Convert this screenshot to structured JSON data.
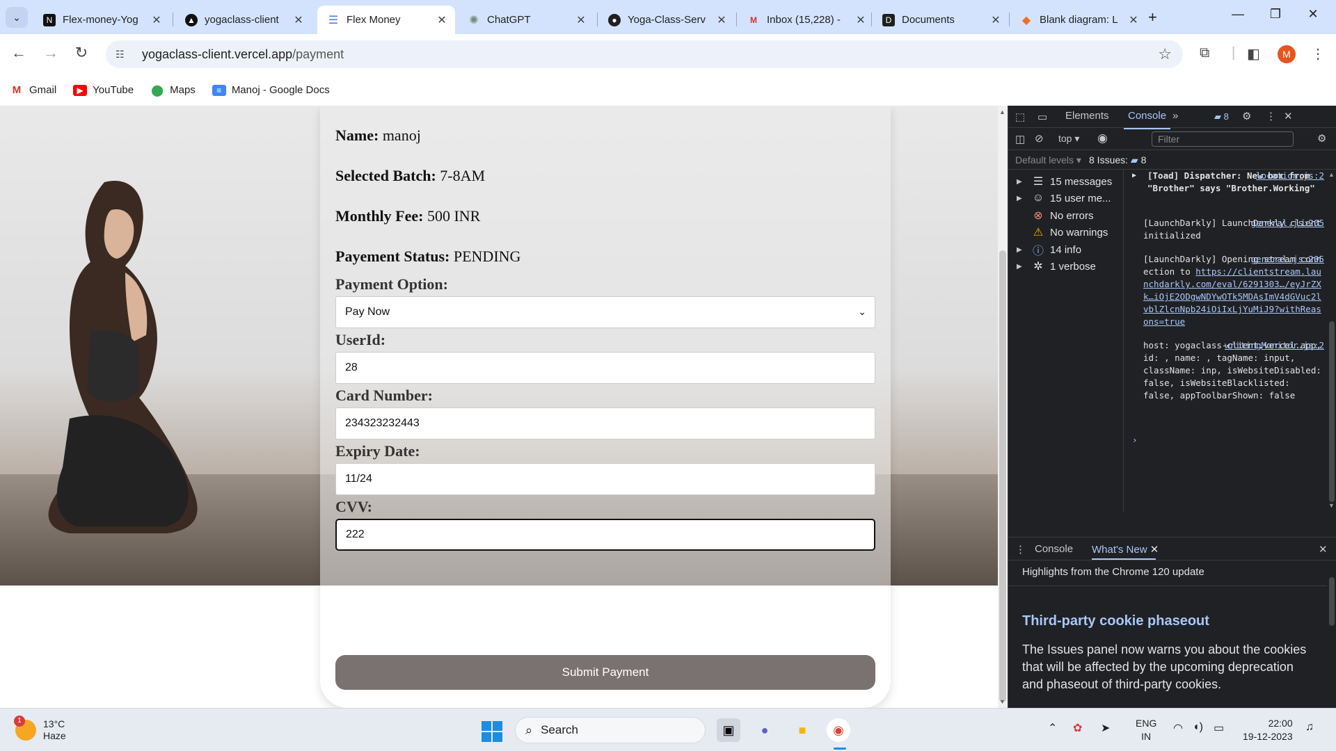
{
  "browser": {
    "tabs": [
      {
        "title": "Flex-money-Yog",
        "active": false
      },
      {
        "title": "yogaclass-client",
        "active": false
      },
      {
        "title": "Flex Money",
        "active": true
      },
      {
        "title": "ChatGPT",
        "active": false
      },
      {
        "title": "Yoga-Class-Serv",
        "active": false
      },
      {
        "title": "Inbox (15,228) -",
        "active": false
      },
      {
        "title": "Documents",
        "active": false
      },
      {
        "title": "Blank diagram: L",
        "active": false
      }
    ],
    "url_host": "yogaclass-client.vercel.app",
    "url_path": "/payment",
    "profile_initial": "M",
    "bookmarks": [
      "Gmail",
      "YouTube",
      "Maps",
      "Manoj - Google Docs"
    ]
  },
  "page": {
    "name_label": "Name:",
    "name_value": "manoj",
    "batch_label": "Selected Batch:",
    "batch_value": "7-8AM",
    "fee_label": "Monthly Fee:",
    "fee_value": "500 INR",
    "status_label": "Payement Status:",
    "status_value": "PENDING",
    "payment_option_label": "Payment Option:",
    "payment_option_value": "Pay Now",
    "userid_label": "UserId:",
    "userid_value": "28",
    "card_label": "Card Number:",
    "card_value": "234323232443",
    "expiry_label": "Expiry Date:",
    "expiry_value": "11/24",
    "cvv_label": "CVV:",
    "cvv_value": "222",
    "submit_label": "Submit Payment"
  },
  "devtools": {
    "tabs": [
      "Elements",
      "Console"
    ],
    "issues_badge": "8",
    "context": "top",
    "filter_placeholder": "Filter",
    "default_levels": "Default levels",
    "issues_label": "8 Issues:",
    "issues_count": "8",
    "sidebar": [
      {
        "label": "15 messages",
        "icon": "list-icon",
        "expandable": true
      },
      {
        "label": "15 user me...",
        "icon": "user-icon",
        "expandable": true
      },
      {
        "label": "No errors",
        "icon": "error-icon",
        "expandable": false
      },
      {
        "label": "No warnings",
        "icon": "warning-icon",
        "expandable": false
      },
      {
        "label": "14 info",
        "icon": "info-icon",
        "expandable": true
      },
      {
        "label": "1 verbose",
        "icon": "bug-icon",
        "expandable": true
      }
    ],
    "log": [
      {
        "src": "location.js:2",
        "text": "[Toad] Dispatcher: New box from \"Brother\" says \"Brother.Working\""
      },
      {
        "src": "general.js:205",
        "text": "[LaunchDarkly] LaunchDarkly client initialized"
      },
      {
        "src": "general.js:205",
        "text": "[LaunchDarkly] Opening stream connection to",
        "link": "https://clientstream.launchdarkly.com/eval/6291303…/eyJrZXk…iOjE2ODgwNDYwOTk5MDAsImV4dGVuc2lvblZlcnNpb24iOiIxLjYuMiJ9?withReasons=true"
      },
      {
        "src": "writingMonitor.js:2",
        "text": "host: yogaclass-client.vercel.app, id: , name: , tagName: input, className: inp, isWebsiteDisabled: false, isWebsiteBlacklisted: false, appToolbarShown: false"
      }
    ],
    "drawer_tabs": [
      "Console",
      "What's New"
    ],
    "whats_new_subtitle": "Highlights from the Chrome 120 update",
    "whats_new_title": "Third-party cookie phaseout",
    "whats_new_text": "The Issues panel now warns you about the cookies that will be affected by the upcoming deprecation and phaseout of third-party cookies."
  },
  "taskbar": {
    "weather_temp": "13°C",
    "weather_desc": "Haze",
    "weather_badge": "1",
    "search_label": "Search",
    "lang": "ENG",
    "region": "IN",
    "time": "22:00",
    "date": "19-12-2023"
  }
}
